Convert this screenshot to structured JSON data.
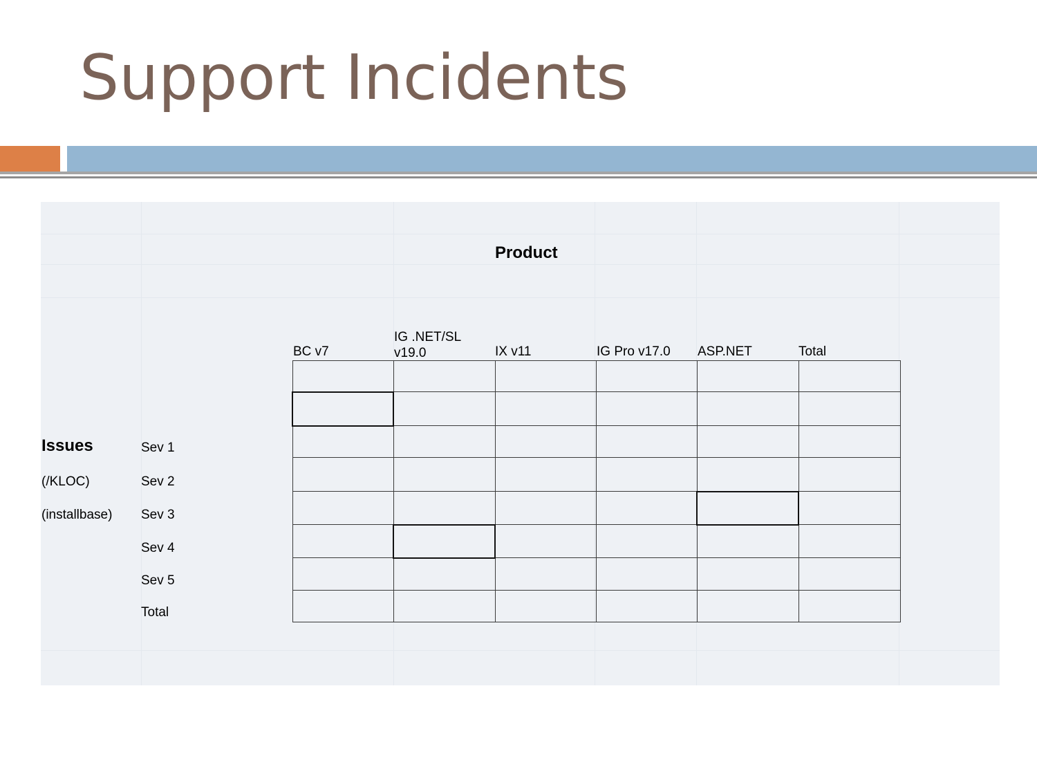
{
  "slide": {
    "title": "Support Incidents"
  },
  "table": {
    "product_header": "Product",
    "row_group_label": "Issues",
    "row_group_sub1": "(/KLOC)",
    "row_group_sub2": "(installbase)",
    "columns": [
      "BC v7",
      "IG .NET/SL\nv19.0",
      "IX v11",
      "IG Pro v17.0",
      "ASP.NET",
      "Total"
    ],
    "rows": [
      "Sev 1",
      "Sev 2",
      "Sev 3",
      "Sev 4",
      "Sev 5",
      "Total"
    ]
  },
  "colors": {
    "title": "#7b6358",
    "accent_orange": "#dd8047",
    "accent_blue": "#94b6d2",
    "panel": "#eef1f5"
  }
}
